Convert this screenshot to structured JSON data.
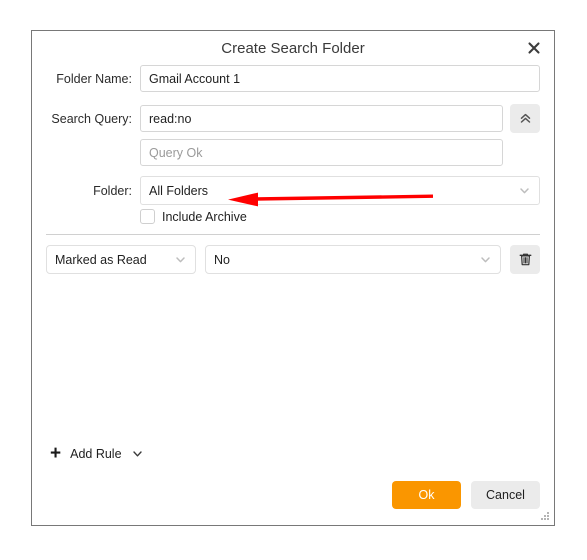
{
  "dialog": {
    "title": "Create Search Folder",
    "close_icon": "close-icon"
  },
  "form": {
    "folder_name": {
      "label": "Folder Name:",
      "value": "Gmail Account 1"
    },
    "search_query": {
      "label": "Search Query:",
      "value": "read:no",
      "collapse_icon": "double-chevron-up-icon"
    },
    "query_status": {
      "value": "Query Ok"
    },
    "folder": {
      "label": "Folder:",
      "value": "All Folders",
      "chevron_icon": "chevron-down-icon"
    },
    "include_archive": {
      "label": "Include Archive",
      "checked": false
    }
  },
  "rules": [
    {
      "condition": "Marked as Read",
      "value": "No",
      "delete_icon": "trash-icon"
    }
  ],
  "footer": {
    "add_rule_label": "Add Rule",
    "add_rule_plus_icon": "plus-icon",
    "add_rule_chevron_icon": "chevron-down-icon",
    "ok_label": "Ok",
    "cancel_label": "Cancel"
  },
  "annotation": {
    "arrow_color": "#FF0000",
    "direction": "left",
    "target": "folder-dropdown"
  },
  "colors": {
    "accent": "#FA9600",
    "button_gray": "#ebebeb",
    "border": "#d6d6d6",
    "dialog_border": "#787878"
  }
}
